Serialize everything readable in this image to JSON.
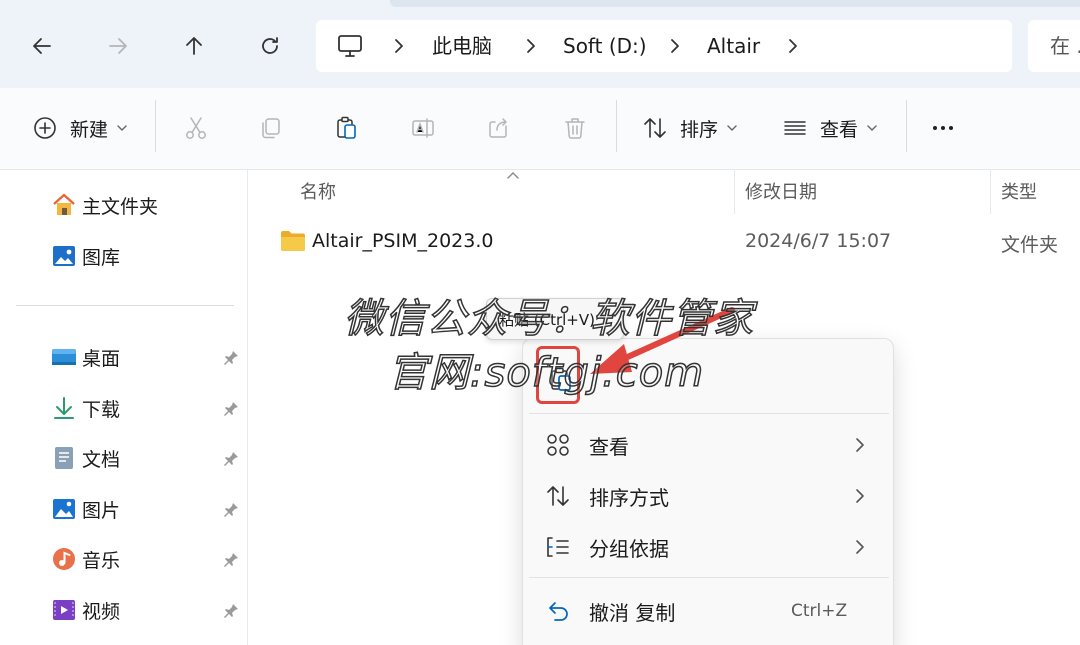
{
  "address": {
    "crumbs": [
      "此电脑",
      "Soft (D:)",
      "Altair"
    ],
    "search_placeholder": "在 ."
  },
  "commands": {
    "new_label": "新建",
    "sort_label": "排序",
    "view_label": "查看"
  },
  "sidebar": {
    "home": "主文件夹",
    "gallery": "图库",
    "pinned": [
      "桌面",
      "下载",
      "文档",
      "图片",
      "音乐",
      "视频"
    ]
  },
  "columns": {
    "name": "名称",
    "modified": "修改日期",
    "type": "类型"
  },
  "files": [
    {
      "name": "Altair_PSIM_2023.0",
      "modified": "2024/6/7 15:07",
      "type": "文件夹"
    }
  ],
  "context_menu": {
    "tooltip": "粘贴 (Ctrl+V)",
    "items": [
      {
        "label": "查看"
      },
      {
        "label": "排序方式"
      },
      {
        "label": "分组依据"
      },
      {
        "label": "撤消 复制",
        "shortcut": "Ctrl+Z"
      }
    ]
  },
  "watermark": {
    "line1": "微信公众号：软件管家",
    "line2": "官网:softgj.com"
  },
  "colors": {
    "accent": "#0067c0",
    "highlight": "#e0463f",
    "folder": "#f4c542"
  }
}
